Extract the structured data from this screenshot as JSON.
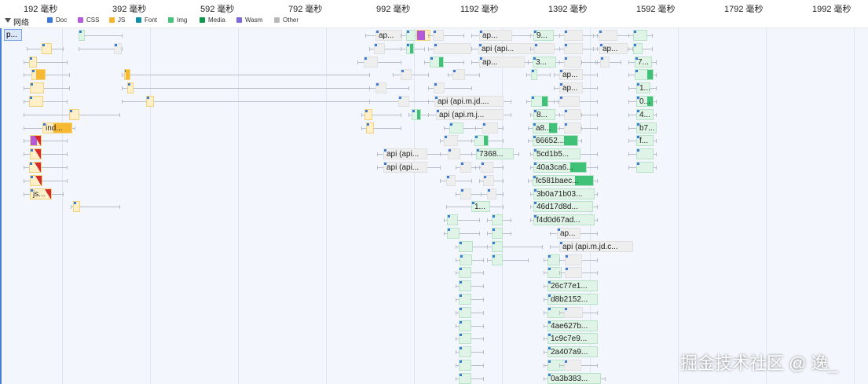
{
  "ruler": {
    "ticks": [
      "192 毫秒",
      "392 毫秒",
      "592 毫秒",
      "792 毫秒",
      "992 毫秒",
      "1192 毫秒",
      "1392 毫秒",
      "1592 毫秒",
      "1792 毫秒",
      "1992 毫秒"
    ]
  },
  "legend": {
    "title": "网络",
    "items": [
      {
        "label": "Doc",
        "color": "#3a78d6"
      },
      {
        "label": "CSS",
        "color": "#b45bd9"
      },
      {
        "label": "JS",
        "color": "#f3b630"
      },
      {
        "label": "Font",
        "color": "#0f8fa8"
      },
      {
        "label": "Img",
        "color": "#49c27b"
      },
      {
        "label": "Media",
        "color": "#13964e"
      },
      {
        "label": "Wasm",
        "color": "#7f69d9"
      },
      {
        "label": "Other",
        "color": "#b9b9b9"
      }
    ]
  },
  "selected_request": "p...",
  "requests": [
    {
      "label": "ind..."
    },
    {
      "label": "js..."
    },
    {
      "label": "ap..."
    },
    {
      "label": "ap..."
    },
    {
      "label": "ap..."
    },
    {
      "label": "api (api..."
    },
    {
      "label": "ap..."
    },
    {
      "label": "api (api.m.jd...."
    },
    {
      "label": "api (api.m.j..."
    },
    {
      "label": "api (api..."
    },
    {
      "label": "api (api..."
    },
    {
      "label": "7368..."
    },
    {
      "label": "1..."
    },
    {
      "label": "9..."
    },
    {
      "label": "3..."
    },
    {
      "label": "ap..."
    },
    {
      "label": "ap..."
    },
    {
      "label": "8..."
    },
    {
      "label": "a8..."
    },
    {
      "label": "66652..."
    },
    {
      "label": "5cd1b5..."
    },
    {
      "label": "40a3ca6..."
    },
    {
      "label": "fc581baec..."
    },
    {
      "label": "3b0a71b03..."
    },
    {
      "label": "46d17d8d..."
    },
    {
      "label": "f4d0d67ad..."
    },
    {
      "label": "ap..."
    },
    {
      "label": "api (api.m.jd.c..."
    },
    {
      "label": "26c77e1..."
    },
    {
      "label": "d8b2152..."
    },
    {
      "label": "4ae627b..."
    },
    {
      "label": "1c9c7e9..."
    },
    {
      "label": "2a407a9..."
    },
    {
      "label": "0a3b383..."
    },
    {
      "label": "ap..."
    },
    {
      "label": "7..."
    },
    {
      "label": "1..."
    },
    {
      "label": "0..."
    },
    {
      "label": "4..."
    },
    {
      "label": "b7..."
    },
    {
      "label": "f..."
    }
  ],
  "watermark": "掘金技术社区 @ 逸_"
}
